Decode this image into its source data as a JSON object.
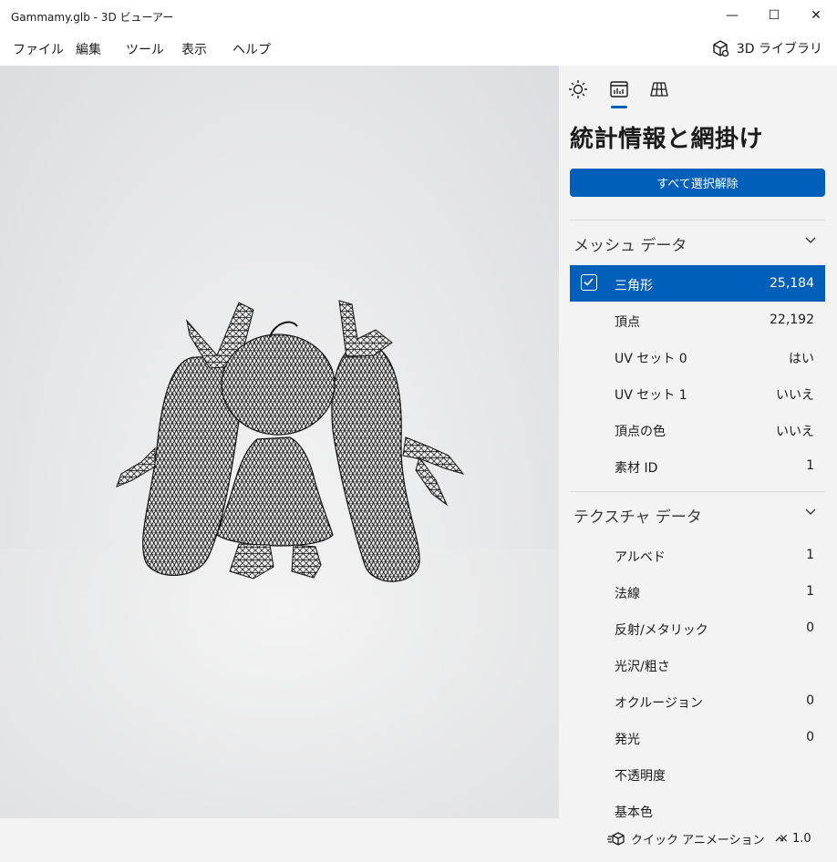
{
  "window": {
    "title": "Gammamy.glb - 3D ビューアー",
    "minimize_symbol": "—",
    "maximize_symbol": "☐",
    "close_symbol": "✕"
  },
  "menu": {
    "items": [
      "ファイル",
      "編集",
      "ツール",
      "表示",
      "ヘルプ"
    ],
    "library_label": "3D ライブラリ"
  },
  "panel": {
    "tabs": [
      {
        "icon": "lighting-icon"
      },
      {
        "icon": "stats-icon",
        "selected": true
      },
      {
        "icon": "grid-icon"
      }
    ],
    "heading": "統計情報と網掛け",
    "deselect_all_label": "すべて選択解除",
    "mesh_section": {
      "title": "メッシュ データ",
      "rows": [
        {
          "label": "三角形",
          "value": "25,184",
          "selected": true
        },
        {
          "label": "頂点",
          "value": "22,192"
        },
        {
          "label": "UV セット 0",
          "value": "はい"
        },
        {
          "label": "UV セット 1",
          "value": "いいえ"
        },
        {
          "label": "頂点の色",
          "value": "いいえ"
        },
        {
          "label": "素材 ID",
          "value": "1"
        }
      ]
    },
    "texture_section": {
      "title": "テクスチャ データ",
      "rows": [
        {
          "label": "アルベド",
          "value": "1"
        },
        {
          "label": "法線",
          "value": "1"
        },
        {
          "label": "反射/メタリック",
          "value": "0"
        },
        {
          "label": "光沢/粗さ",
          "value": ""
        },
        {
          "label": "オクルージョン",
          "value": "0"
        },
        {
          "label": "発光",
          "value": "0"
        },
        {
          "label": "不透明度",
          "value": ""
        },
        {
          "label": "基本色",
          "value": ""
        }
      ]
    }
  },
  "statusbar": {
    "quick_animation_label": "クイック アニメーション",
    "zoom_label": "× 1.0"
  },
  "colors": {
    "accent": "#005fb8",
    "panel_bg": "#f3f3f3"
  }
}
